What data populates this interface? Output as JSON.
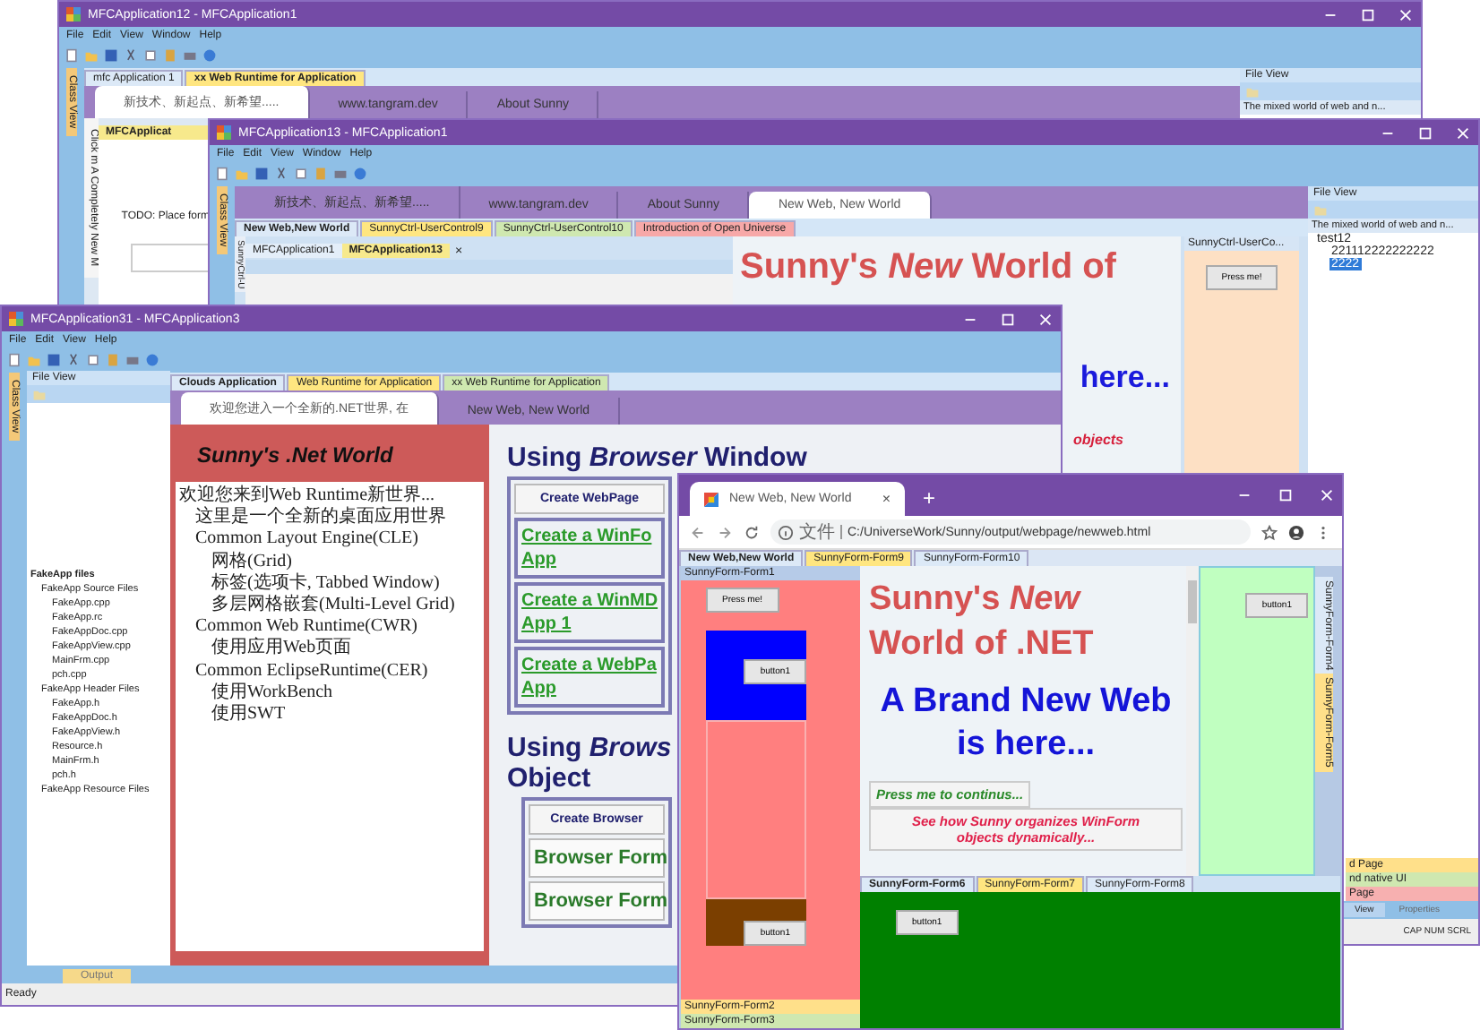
{
  "back_window": {
    "title": "MFCApplication12 - MFCApplication1",
    "menu": [
      "File",
      "Edit",
      "View",
      "Window",
      "Help"
    ],
    "side_tab": "Class View",
    "doc_tabs": [
      {
        "label": "mfc Application 1",
        "selected": false,
        "color": "#dce9f7"
      },
      {
        "label": "xx Web Runtime for Application",
        "selected": true,
        "color": "#ffe680"
      }
    ],
    "browser_tabs": [
      {
        "label": "新技术、新起点、新希望.....",
        "selected": true
      },
      {
        "label": "www.tangram.dev",
        "selected": false
      },
      {
        "label": "About Sunny",
        "selected": false
      }
    ],
    "vertical_tab": "Click m  A Completely New M",
    "mdi_tab": "MFCApplicat",
    "todo_text": "TODO: Place form",
    "file_view": {
      "title": "File View",
      "caption": "The mixed world of web and n..."
    }
  },
  "middle_window": {
    "title": "MFCApplication13 - MFCApplication1",
    "menu": [
      "File",
      "Edit",
      "View",
      "Window",
      "Help"
    ],
    "side_tab": "Class View",
    "browser_tabs": [
      {
        "label": "新技术、新起点、新希望.....",
        "selected": false
      },
      {
        "label": "www.tangram.dev",
        "selected": false
      },
      {
        "label": "About Sunny",
        "selected": false
      },
      {
        "label": "New Web, New World",
        "selected": true
      }
    ],
    "sub_tabs": [
      {
        "label": "New Web,New World",
        "selected": true,
        "color": "#dce9f7"
      },
      {
        "label": "SunnyCtrl-UserControl9",
        "selected": false,
        "color": "#ffe680"
      },
      {
        "label": "SunnyCtrl-UserControl10",
        "selected": false,
        "color": "#cfe8b0"
      },
      {
        "label": "Introduction of Open Universe",
        "selected": false,
        "color": "#f7a8a8"
      }
    ],
    "vertical_tab": "SunnyCtrl-U",
    "mdi_tabs": [
      {
        "label": "MFCApplication1",
        "selected": false
      },
      {
        "label": "MFCApplication13",
        "selected": true
      }
    ],
    "mdi_close": "×",
    "web_heading": "Sunny's *New* World of",
    "web_subheading": "here...",
    "web_link": "objects",
    "panel": {
      "title": "SunnyCtrl-UserCo...",
      "button": "Press me!"
    },
    "file_view": {
      "title": "File View",
      "caption": "The mixed world of web and n...",
      "tree": [
        {
          "label": "test12",
          "selected": false,
          "children": [
            {
              "label": "221112222222222",
              "selected": false
            },
            {
              "label": "2222",
              "selected": true
            }
          ]
        }
      ],
      "bottom_tabs": [
        {
          "label": "d Page",
          "color": "#ffe08a"
        },
        {
          "label": "nd native UI",
          "color": "#cfe8b0"
        },
        {
          "label": "Page",
          "color": "#f7b0b0"
        }
      ],
      "pane_tabs": [
        {
          "label": "View",
          "selected": true
        },
        {
          "label": "Properties",
          "selected": false
        }
      ]
    },
    "status": "CAP NUM SCRL"
  },
  "left_window": {
    "title": "MFCApplication31 - MFCApplication3",
    "menu": [
      "File",
      "Edit",
      "View",
      "Help"
    ],
    "side_tab": "Class View",
    "file_view": {
      "title": "File View",
      "tree": [
        {
          "label": "FakeApp files",
          "children": [
            {
              "label": "FakeApp Source Files",
              "children": [
                {
                  "label": "FakeApp.cpp"
                },
                {
                  "label": "FakeApp.rc"
                },
                {
                  "label": "FakeAppDoc.cpp"
                },
                {
                  "label": "FakeAppView.cpp"
                },
                {
                  "label": "MainFrm.cpp"
                },
                {
                  "label": "pch.cpp"
                }
              ]
            },
            {
              "label": "FakeApp Header Files",
              "children": [
                {
                  "label": "FakeApp.h"
                },
                {
                  "label": "FakeAppDoc.h"
                },
                {
                  "label": "FakeAppView.h"
                },
                {
                  "label": "Resource.h"
                },
                {
                  "label": "MainFrm.h"
                },
                {
                  "label": "pch.h"
                }
              ]
            },
            {
              "label": "FakeApp Resource Files"
            }
          ]
        }
      ]
    },
    "doc_tabs": [
      {
        "label": "Clouds Application",
        "selected": true,
        "color": "#dce9f7"
      },
      {
        "label": "Web Runtime for Application",
        "selected": false,
        "color": "#ffe680"
      },
      {
        "label": "xx Web Runtime for Application",
        "selected": false,
        "color": "#cfe8b0"
      }
    ],
    "browser_tabs": [
      {
        "label": "欢迎您进入一个全新的.NET世界, 在",
        "selected": true
      },
      {
        "label": "New Web, New World",
        "selected": false
      }
    ],
    "tree_panel": {
      "title": "Sunny's .Net World",
      "tree": [
        {
          "label": "欢迎您来到Web Runtime新世界...",
          "children": [
            {
              "label": "这里是一个全新的桌面应用世界"
            },
            {
              "label": "Common Layout Engine(CLE)",
              "children": [
                {
                  "label": "网格(Grid)"
                },
                {
                  "label": "标签(选项卡, Tabbed Window)"
                },
                {
                  "label": "多层网格嵌套(Multi-Level Grid)"
                }
              ]
            },
            {
              "label": "Common Web Runtime(CWR)",
              "children": [
                {
                  "label": "使用应用Web页面"
                }
              ]
            },
            {
              "label": "Common EclipseRuntime(CER)",
              "children": [
                {
                  "label": "使用WorkBench"
                },
                {
                  "label": "使用SWT"
                }
              ]
            }
          ]
        }
      ]
    },
    "content": {
      "heading": "Using *Browser* Window",
      "header_button": "Create WebPage",
      "links": [
        "Create a WinFo\nApp",
        "Create a WinMD\nApp 1",
        "Create a WebPa\nApp"
      ],
      "heading2": "Using *Brows*\nObject",
      "header_button2": "Create Browser",
      "buttons": [
        "Browser Form",
        "Browser Form"
      ]
    },
    "output_tab": "Output",
    "status": "Ready"
  },
  "browser_window": {
    "tab": {
      "label": "New Web, New World",
      "close": "×"
    },
    "new_tab": "+",
    "address": {
      "scheme": "文件",
      "url": "C:/UniverseWork/Sunny/output/webpage/newweb.html"
    },
    "doc_tabs": [
      {
        "label": "New Web,New World",
        "selected": true,
        "color": "#dce9f7"
      },
      {
        "label": "SunnyForm-Form9",
        "selected": false,
        "color": "#ffe680"
      },
      {
        "label": "SunnyForm-Form10",
        "selected": false,
        "color": "#dce9f7"
      }
    ],
    "left_pane": {
      "title": "SunnyForm-Form1",
      "press_button": "Press me!",
      "buttons": [
        "button1",
        "button1"
      ],
      "tabs": [
        {
          "label": "SunnyForm-Form2",
          "color": "#ffe08a"
        },
        {
          "label": "SunnyForm-Form3",
          "color": "#cfe8b0"
        }
      ]
    },
    "web": {
      "heading": "Sunny's *New*\nWorld of .NET",
      "subheading": "A Brand New Web\nis here...",
      "buttons": [
        {
          "kind": "continue",
          "label": "Press me to continus..."
        },
        {
          "kind": "info",
          "label": "See how Sunny organizes WinForm\nobjects dynamically..."
        }
      ]
    },
    "right_pane": {
      "button": "button1",
      "side_tabs": [
        {
          "label": "SunnyForm-Form4",
          "color": "#dce9f7"
        },
        {
          "label": "SunnyForm-Form5",
          "color": "#ffe08a"
        }
      ]
    },
    "bottom_pane": {
      "tabs": [
        {
          "label": "SunnyForm-Form6",
          "selected": true,
          "color": "#dce9f7"
        },
        {
          "label": "SunnyForm-Form7",
          "selected": false,
          "color": "#ffe680"
        },
        {
          "label": "SunnyForm-Form8",
          "selected": false,
          "color": "#dce9f7"
        }
      ],
      "button": "button1"
    }
  }
}
